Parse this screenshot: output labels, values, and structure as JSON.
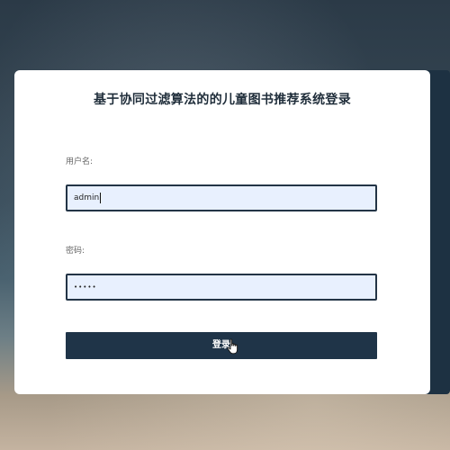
{
  "login": {
    "title": "基于协同过滤算法的的儿童图书推荐系统登录",
    "username_label": "用户名:",
    "username_value": "admin",
    "password_label": "密码:",
    "password_value": "•••••",
    "submit_label": "登录"
  },
  "colors": {
    "accent": "#1f3448",
    "input_bg": "#e8f0fe",
    "input_border": "#233446"
  },
  "icons": {
    "cursor": "hand-pointer-icon"
  }
}
